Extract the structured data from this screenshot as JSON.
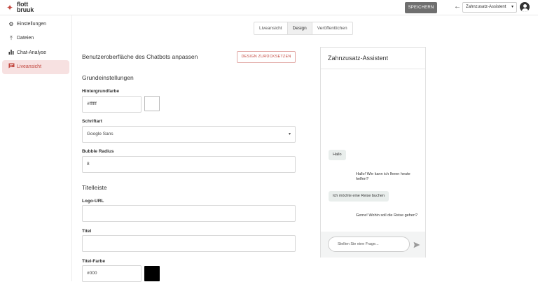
{
  "header": {
    "logo_line1": "flott",
    "logo_line2": "bruuk",
    "save_label": "SPEICHERN",
    "bot_name": "Zahnzusatz-Assistent"
  },
  "sidebar": {
    "items": [
      {
        "label": "Einstellungen",
        "icon": "gear-icon"
      },
      {
        "label": "Dateien",
        "icon": "upload-icon"
      },
      {
        "label": "Chat-Analyse",
        "icon": "bar-chart-icon"
      },
      {
        "label": "Liveansicht",
        "icon": "chat-icon"
      }
    ]
  },
  "tabs": [
    {
      "label": "Liveansicht"
    },
    {
      "label": "Design"
    },
    {
      "label": "Veröffentlichen"
    }
  ],
  "form": {
    "title": "Benutzeroberfläche des Chatbots anpassen",
    "reset_label": "DESIGN ZURÜCKSETZEN",
    "section_basic": "Grundeinstellungen",
    "bg_label": "Hintergrundfarbe",
    "bg_value": "#ffffff",
    "font_label": "Schriftart",
    "font_value": "Google Sans",
    "radius_label": "Bubble Radius",
    "radius_value": "8",
    "section_titlebar": "Titelleiste",
    "logo_label": "Logo-URL",
    "logo_value": "",
    "title_label": "Titel",
    "title_value": "",
    "title_color_label": "Titel-Farbe",
    "title_color_value": "#000"
  },
  "preview": {
    "title": "Zahnzusatz-Assistent",
    "messages": [
      {
        "role": "user",
        "text": "Hallo"
      },
      {
        "role": "bot",
        "text": "Hallo! Wie kann ich Ihnen heute helfen?"
      },
      {
        "role": "user",
        "text": "Ich möchte eine Reise buchen"
      },
      {
        "role": "bot",
        "text": "Gerne! Wohin soll die Reise gehen?"
      }
    ],
    "input_placeholder": "Stellen Sie eine Frage..."
  },
  "colors": {
    "accent": "#c2473f",
    "active_bg": "#f7e1e1",
    "bg_swatch": "#ffffff",
    "title_swatch": "#000000"
  }
}
